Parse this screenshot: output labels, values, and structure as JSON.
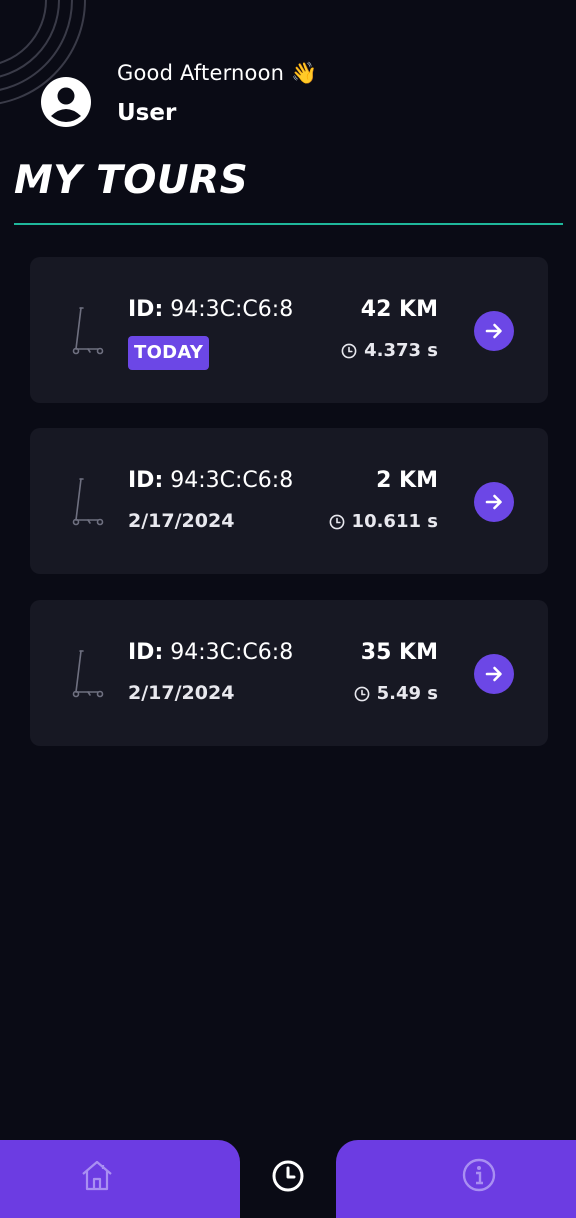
{
  "header": {
    "greeting": "Good Afternoon 👋",
    "username": "User"
  },
  "page_title": "MY TOURS",
  "tours": [
    {
      "id_label": "ID:",
      "id_value": "94:3C:C6:8",
      "date": "TODAY",
      "is_today": true,
      "distance": "42 KM",
      "duration": "4.373 s"
    },
    {
      "id_label": "ID:",
      "id_value": "94:3C:C6:8",
      "date": "2/17/2024",
      "is_today": false,
      "distance": "2 KM",
      "duration": "10.611 s"
    },
    {
      "id_label": "ID:",
      "id_value": "94:3C:C6:8",
      "date": "2/17/2024",
      "is_today": false,
      "distance": "35 KM",
      "duration": "5.49 s"
    }
  ],
  "nav": {
    "items": [
      {
        "icon": "home-icon",
        "active": false
      },
      {
        "icon": "history-clock-icon",
        "active": true
      },
      {
        "icon": "info-icon",
        "active": false
      }
    ]
  },
  "colors": {
    "background": "#0a0b15",
    "card": "#171823",
    "accent": "#6c47e6",
    "nav": "#6c3ce2",
    "divider": "#1fb79b"
  }
}
